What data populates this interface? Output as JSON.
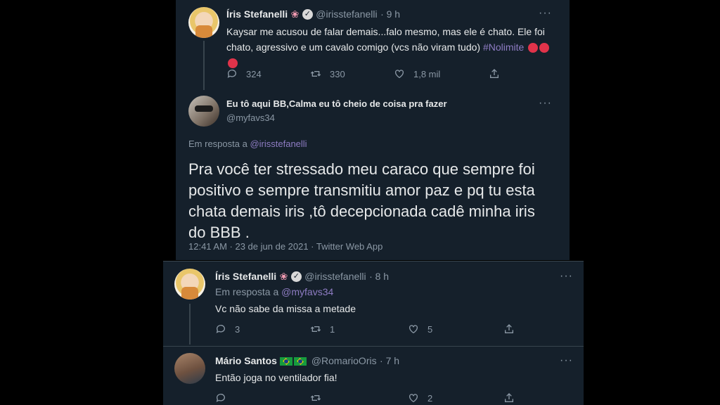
{
  "tweet1": {
    "name": "Íris Stefanelli",
    "handle": "@irisstefanelli",
    "time": "· 9 h",
    "text": "Kaysar me acusou de falar demais...falo mesmo, mas ele é chato. Ele foi chato, agressivo e um cavalo comigo (vcs não viram tudo)",
    "hashtag": "#Nolimite",
    "replies": "324",
    "retweets": "330",
    "likes": "1,8 mil"
  },
  "tweet2": {
    "name": "Eu tô aqui BB,Calma eu tô cheio de coisa pra fazer",
    "handle": "@myfavs34",
    "reply_prefix": "Em resposta a",
    "reply_to": "@irisstefanelli",
    "text": "Pra você ter stressado meu caraco que sempre foi positivo e sempre transmitiu amor paz e pq tu esta chata demais iris ,tô decepcionada cadê minha iris do BBB .",
    "meta": "12:41 AM · 23 de jun de 2021 · Twitter Web App"
  },
  "tweet3": {
    "name": "Íris Stefanelli",
    "handle": "@irisstefanelli",
    "time": "· 8 h",
    "reply_prefix": "Em resposta a",
    "reply_to": "@myfavs34",
    "text": "Vc não sabe da missa a metade",
    "replies": "3",
    "retweets": "1",
    "likes": "5"
  },
  "tweet4": {
    "name": "Mário Santos",
    "handle": "@RomarioOris",
    "time": "· 7 h",
    "text": "Então joga no ventilador fia!",
    "replies": "",
    "retweets": "",
    "likes": "2"
  },
  "icons": {
    "more": "···",
    "verified": "✓",
    "flower": "❀"
  }
}
